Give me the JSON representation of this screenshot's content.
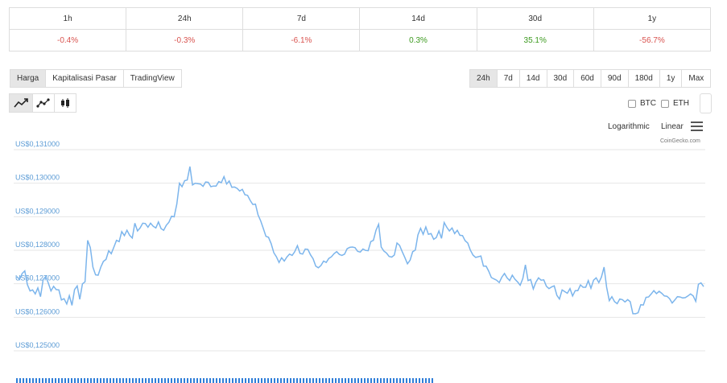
{
  "performance": {
    "periods": [
      "1h",
      "24h",
      "7d",
      "14d",
      "30d",
      "1y"
    ],
    "changes": [
      "-0.4%",
      "-0.3%",
      "-6.1%",
      "0.3%",
      "35.1%",
      "-56.7%"
    ],
    "colors": {
      "negative": "#d9534f",
      "positive": "#3c9a1f"
    }
  },
  "view_tabs": [
    "Harga",
    "Kapitalisasi Pasar",
    "TradingView"
  ],
  "active_view": "Harga",
  "range_tabs": [
    "24h",
    "7d",
    "14d",
    "30d",
    "60d",
    "90d",
    "180d",
    "1y",
    "Max"
  ],
  "active_range": "24h",
  "chart_type_icons": [
    "line-chart-icon",
    "point-line-chart-icon",
    "candlestick-chart-icon"
  ],
  "compare": {
    "btc": "BTC",
    "eth": "ETH"
  },
  "scale": {
    "log": "Logarithmic",
    "linear": "Linear"
  },
  "credit": "CoinGecko.com",
  "chart_data": {
    "type": "line",
    "title": "",
    "xlabel": "",
    "ylabel": "",
    "y_tick_labels": [
      "US$0,131000",
      "US$0,130000",
      "US$0,129000",
      "US$0,128000",
      "US$0,127000",
      "US$0,126000",
      "US$0,125000"
    ],
    "y_ticks": [
      0.131,
      0.13,
      0.129,
      0.128,
      0.127,
      0.126,
      0.125
    ],
    "ylim": [
      0.125,
      0.131
    ],
    "grid": true,
    "line_color": "#7cb5ec",
    "series": [
      {
        "values": [
          0.12712,
          0.12703,
          0.12721,
          0.12729,
          0.12688,
          0.12669,
          0.12672,
          0.1266,
          0.12678,
          0.12652,
          0.12703,
          0.12712,
          0.12692,
          0.12669,
          0.12683,
          0.12673,
          0.12672,
          0.12642,
          0.12646,
          0.1263,
          0.12655,
          0.12626,
          0.12673,
          0.12684,
          0.12644,
          0.1269,
          0.12696,
          0.1282,
          0.12798,
          0.1274,
          0.12717,
          0.12716,
          0.1274,
          0.12757,
          0.12763,
          0.12789,
          0.1278,
          0.128,
          0.1282,
          0.12816,
          0.12846,
          0.12834,
          0.1285,
          0.12835,
          0.12827,
          0.12871,
          0.12848,
          0.12857,
          0.12871,
          0.1287,
          0.12859,
          0.12871,
          0.12862,
          0.12857,
          0.12875,
          0.12855,
          0.1285,
          0.12865,
          0.12874,
          0.12892,
          0.1289,
          0.12928,
          0.1299,
          0.1298,
          0.12998,
          0.13,
          0.1304,
          0.12985,
          0.1299,
          0.12989,
          0.12988,
          0.12981,
          0.12994,
          0.12993,
          0.1298,
          0.12982,
          0.12982,
          0.12995,
          0.12992,
          0.1301,
          0.12988,
          0.12997,
          0.12978,
          0.12979,
          0.12975,
          0.12967,
          0.12972,
          0.12956,
          0.12954,
          0.12939,
          0.12927,
          0.12928,
          0.12896,
          0.12878,
          0.12856,
          0.12832,
          0.12829,
          0.1281,
          0.12783,
          0.12771,
          0.12754,
          0.12768,
          0.12758,
          0.1277,
          0.12779,
          0.12775,
          0.12786,
          0.12804,
          0.12781,
          0.12779,
          0.12794,
          0.12793,
          0.12777,
          0.12765,
          0.12743,
          0.12738,
          0.12745,
          0.12758,
          0.12754,
          0.12766,
          0.12771,
          0.1278,
          0.12786,
          0.12778,
          0.12775,
          0.12779,
          0.12795,
          0.12799,
          0.128,
          0.12798,
          0.12787,
          0.12785,
          0.12794,
          0.1279,
          0.12789,
          0.12816,
          0.1282,
          0.1285,
          0.12868,
          0.128,
          0.12788,
          0.12782,
          0.12772,
          0.1277,
          0.12776,
          0.12812,
          0.12805,
          0.12786,
          0.12769,
          0.1275,
          0.12761,
          0.12786,
          0.12791,
          0.12836,
          0.12856,
          0.12838,
          0.1286,
          0.12838,
          0.1284,
          0.12823,
          0.12828,
          0.12848,
          0.12826,
          0.12873,
          0.12859,
          0.12848,
          0.12857,
          0.1284,
          0.1285,
          0.12835,
          0.12834,
          0.12819,
          0.12812,
          0.12791,
          0.12776,
          0.12769,
          0.12771,
          0.12773,
          0.12743,
          0.12743,
          0.12728,
          0.12709,
          0.12705,
          0.12701,
          0.12694,
          0.1271,
          0.12721,
          0.12708,
          0.127,
          0.12716,
          0.12704,
          0.12696,
          0.12686,
          0.12706,
          0.12747,
          0.127,
          0.12703,
          0.12675,
          0.12695,
          0.12708,
          0.12701,
          0.12702,
          0.12683,
          0.12676,
          0.12681,
          0.12684,
          0.12656,
          0.12645,
          0.12672,
          0.12667,
          0.12662,
          0.12676,
          0.12654,
          0.1267,
          0.1267,
          0.12687,
          0.1268,
          0.1268,
          0.127,
          0.12677,
          0.12701,
          0.12708,
          0.12694,
          0.1271,
          0.1274,
          0.1268,
          0.1264,
          0.12652,
          0.12637,
          0.12631,
          0.12645,
          0.12643,
          0.12636,
          0.12643,
          0.12637,
          0.12601,
          0.12601,
          0.12604,
          0.12628,
          0.12627,
          0.1265,
          0.12651,
          0.1266,
          0.1267,
          0.12661,
          0.12668,
          0.12662,
          0.12654,
          0.12653,
          0.12646,
          0.12633,
          0.12642,
          0.12652,
          0.12651,
          0.12648,
          0.12649,
          0.12654,
          0.1266,
          0.12654,
          0.12638,
          0.12689,
          0.12693,
          0.12682
        ]
      }
    ]
  }
}
